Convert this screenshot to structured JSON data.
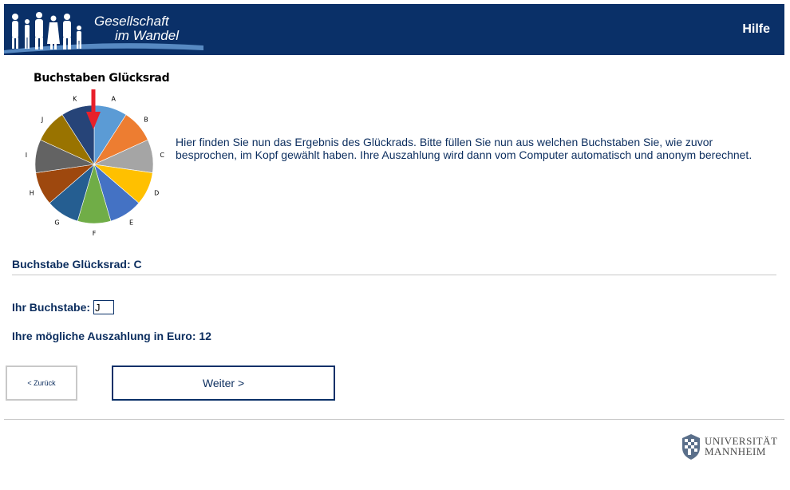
{
  "header": {
    "brand_line1": "Gesellschaft",
    "brand_line2": "im Wandel",
    "help": "Hilfe",
    "bg_color": "#0a3068"
  },
  "wheel": {
    "title": "Buchstaben Glücksrad",
    "segments": [
      {
        "label": "A",
        "color": "#5b9bd5"
      },
      {
        "label": "B",
        "color": "#ed7d31"
      },
      {
        "label": "C",
        "color": "#a5a5a5"
      },
      {
        "label": "D",
        "color": "#ffc000"
      },
      {
        "label": "E",
        "color": "#4472c4"
      },
      {
        "label": "F",
        "color": "#70ad47"
      },
      {
        "label": "G",
        "color": "#255e91"
      },
      {
        "label": "H",
        "color": "#9e480e"
      },
      {
        "label": "I",
        "color": "#636363"
      },
      {
        "label": "J",
        "color": "#997300"
      },
      {
        "label": "K",
        "color": "#264478"
      }
    ],
    "pointer": "arrow-down-icon"
  },
  "intro": "Hier finden Sie nun das Ergebnis des Glückrads. Bitte füllen Sie nun aus welchen Buchstaben Sie, wie zuvor besprochen, im Kopf gewählt haben. Ihre Auszahlung wird dann vom Computer automatisch und anonym berechnet.",
  "result": {
    "label": "Buchstabe Glücksrad: C"
  },
  "form": {
    "letter_label": "Ihr Buchstabe:",
    "letter_value": "J",
    "payout_label": "Ihre mögliche Auszahlung in Euro: 12"
  },
  "nav": {
    "back": "< Zurück",
    "next": "Weiter >"
  },
  "footer": {
    "uni_line1": "UNIVERSITÄT",
    "uni_line2": "MANNHEIM"
  }
}
